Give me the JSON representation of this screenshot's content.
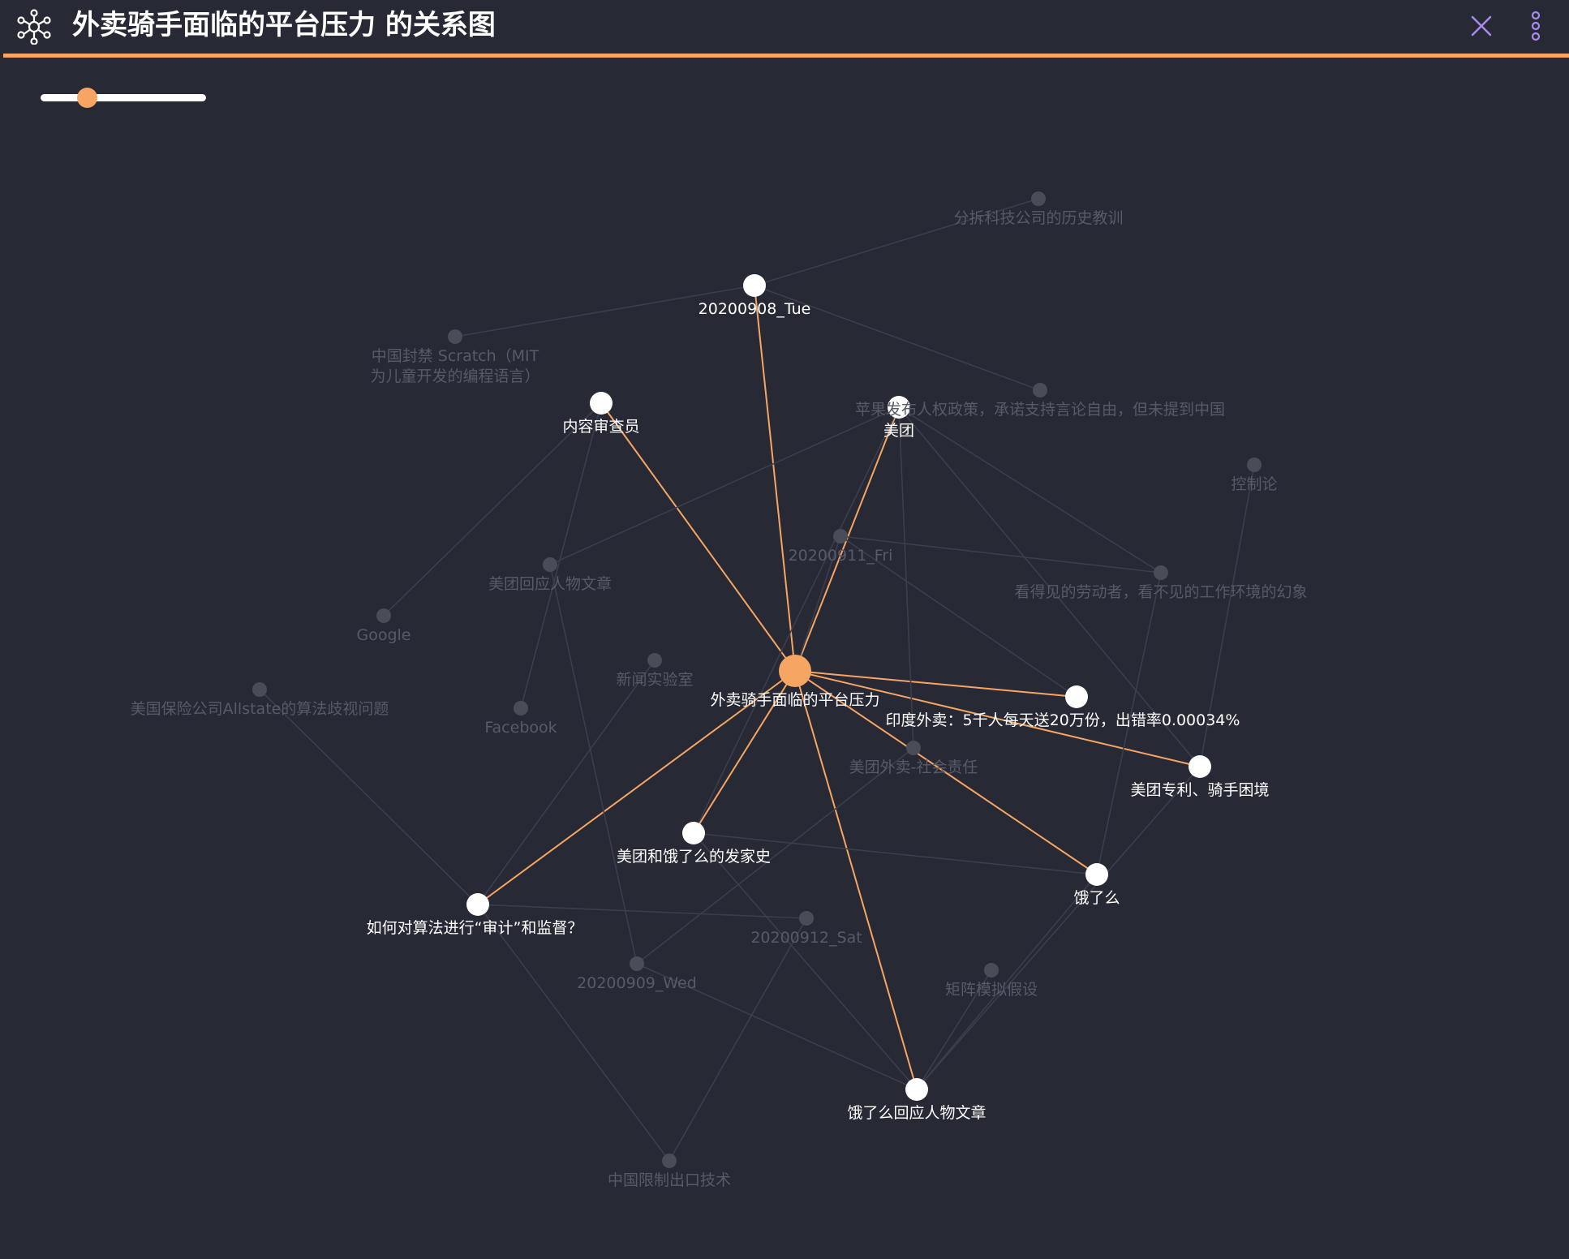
{
  "header": {
    "title": "外卖骑手面临的平台压力 的关系图",
    "icons": {
      "graph": "graph-network-icon",
      "close": "close-icon",
      "more": "more-vertical-icon"
    }
  },
  "slider": {
    "value": 0.28
  },
  "colors": {
    "background": "#272935",
    "accent": "#F6A562",
    "active_node": "#FFFFFF",
    "inactive_node": "#4A4C58",
    "inactive_label": "#575A69",
    "active_edge": "#F6A562",
    "inactive_edge": "#3B3E4E",
    "close_icon": "#A98BF0",
    "more_icon": "#A98BF0"
  },
  "graph": {
    "center_node": "外卖骑手面临的平台压力",
    "nodes": [
      {
        "id": "center",
        "label": "外卖骑手面临的平台压力",
        "type": "center"
      },
      {
        "id": "n0908",
        "label": "20200908_Tue",
        "type": "active"
      },
      {
        "id": "content",
        "label": "内容审查员",
        "type": "active"
      },
      {
        "id": "meituan",
        "label": "美团",
        "type": "active"
      },
      {
        "id": "india",
        "label": "印度外卖：5千人每天送20万份，出错率0.00034%",
        "type": "active"
      },
      {
        "id": "patent",
        "label": "美团专利、骑手困境",
        "type": "active"
      },
      {
        "id": "eleme",
        "label": "饿了么",
        "type": "active"
      },
      {
        "id": "history",
        "label": "美团和饿了么的发家史",
        "type": "active"
      },
      {
        "id": "audit",
        "label": "如何对算法进行“审计”和监督？",
        "type": "active"
      },
      {
        "id": "elemeReply",
        "label": "饿了么回应人物文章",
        "type": "active"
      },
      {
        "id": "split",
        "label": "分拆科技公司的历史教训",
        "type": "inactive"
      },
      {
        "id": "scratch",
        "label": "中国封禁 Scratch（MIT\n为儿童开发的编程语言）",
        "type": "inactive"
      },
      {
        "id": "apple",
        "label": "苹果发布人权政策，承诺支持言论自由，但未提到中国",
        "type": "inactive"
      },
      {
        "id": "control",
        "label": "控制论",
        "type": "inactive"
      },
      {
        "id": "n0911",
        "label": "20200911_Fri",
        "type": "inactive"
      },
      {
        "id": "workers",
        "label": "看得见的劳动者，看不见的工作环境的幻象",
        "type": "inactive"
      },
      {
        "id": "mtReply",
        "label": "美团回应人物文章",
        "type": "inactive"
      },
      {
        "id": "google",
        "label": "Google",
        "type": "inactive"
      },
      {
        "id": "newslab",
        "label": "新闻实验室",
        "type": "inactive"
      },
      {
        "id": "allstate",
        "label": "美国保险公司Allstate的算法歧视问题",
        "type": "inactive"
      },
      {
        "id": "facebook",
        "label": "Facebook",
        "type": "inactive"
      },
      {
        "id": "csr",
        "label": "美团外卖-社会责任",
        "type": "inactive"
      },
      {
        "id": "n0912",
        "label": "20200912_Sat",
        "type": "inactive"
      },
      {
        "id": "n0909",
        "label": "20200909_Wed",
        "type": "inactive"
      },
      {
        "id": "matrix",
        "label": "矩阵模拟假设",
        "type": "inactive"
      },
      {
        "id": "export",
        "label": "中国限制出口技术",
        "type": "inactive"
      }
    ],
    "edges": [
      {
        "source": "center",
        "target": "n0908",
        "active": true
      },
      {
        "source": "center",
        "target": "content",
        "active": true
      },
      {
        "source": "center",
        "target": "meituan",
        "active": true
      },
      {
        "source": "center",
        "target": "india",
        "active": true
      },
      {
        "source": "center",
        "target": "patent",
        "active": true
      },
      {
        "source": "center",
        "target": "eleme",
        "active": true
      },
      {
        "source": "center",
        "target": "history",
        "active": true
      },
      {
        "source": "center",
        "target": "audit",
        "active": true
      },
      {
        "source": "center",
        "target": "elemeReply",
        "active": true
      },
      {
        "source": "n0908",
        "target": "scratch",
        "active": false
      },
      {
        "source": "n0908",
        "target": "split",
        "active": false
      },
      {
        "source": "n0908",
        "target": "apple",
        "active": false
      },
      {
        "source": "content",
        "target": "google",
        "active": false
      },
      {
        "source": "content",
        "target": "facebook",
        "active": false
      },
      {
        "source": "meituan",
        "target": "mtReply",
        "active": false
      },
      {
        "source": "meituan",
        "target": "workers",
        "active": false
      },
      {
        "source": "meituan",
        "target": "patent",
        "active": false
      },
      {
        "source": "meituan",
        "target": "csr",
        "active": false
      },
      {
        "source": "meituan",
        "target": "history",
        "active": false
      },
      {
        "source": "n0911",
        "target": "workers",
        "active": false
      },
      {
        "source": "n0911",
        "target": "india",
        "active": false
      },
      {
        "source": "n0911",
        "target": "center",
        "active": false
      },
      {
        "source": "mtReply",
        "target": "n0909",
        "active": false
      },
      {
        "source": "workers",
        "target": "eleme",
        "active": false
      },
      {
        "source": "control",
        "target": "patent",
        "active": false
      },
      {
        "source": "newslab",
        "target": "audit",
        "active": false
      },
      {
        "source": "allstate",
        "target": "audit",
        "active": false
      },
      {
        "source": "audit",
        "target": "n0912",
        "active": false
      },
      {
        "source": "audit",
        "target": "export",
        "active": false
      },
      {
        "source": "history",
        "target": "eleme",
        "active": false
      },
      {
        "source": "history",
        "target": "elemeReply",
        "active": false
      },
      {
        "source": "csr",
        "target": "n0909",
        "active": false
      },
      {
        "source": "n0909",
        "target": "elemeReply",
        "active": false
      },
      {
        "source": "n0912",
        "target": "export",
        "active": false
      },
      {
        "source": "patent",
        "target": "elemeReply",
        "active": false
      },
      {
        "source": "eleme",
        "target": "elemeReply",
        "active": false
      },
      {
        "source": "matrix",
        "target": "elemeReply",
        "active": false
      }
    ]
  }
}
